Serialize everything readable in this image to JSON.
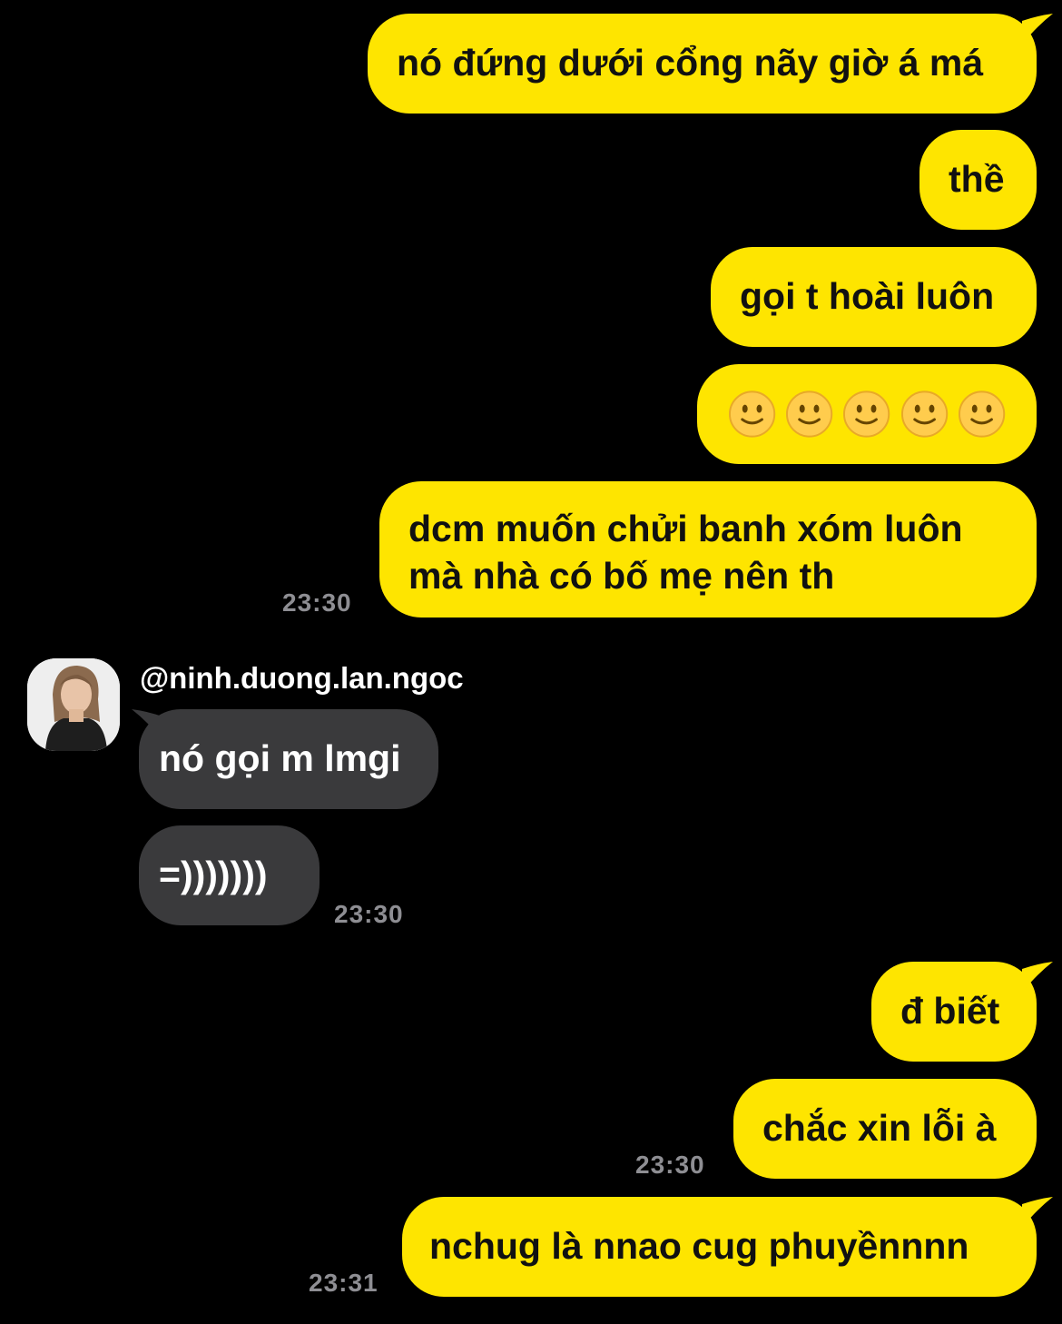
{
  "conversation": {
    "other_user": {
      "handle": "@ninh.duong.lan.ngoc",
      "avatar": "user-avatar-photo"
    },
    "colors": {
      "my_bubble": "#FEE500",
      "their_bubble": "#3A3A3C",
      "timestamp": "#8E8E93",
      "background": "#000000"
    },
    "messages": {
      "m1": "nó đứng dưới cổng nãy giờ á má",
      "m2": "thề",
      "m3": "gọi t hoài luôn",
      "m4_emoji": "slightly-smiling-face x5",
      "m5_line1": "dcm muốn chửi banh xóm luôn",
      "m5_line2": "mà nhà có bố mẹ nên th",
      "m5_time": "23:30",
      "r1": "nó gọi m lmgi",
      "r2": "=)))))))",
      "r2_time": "23:30",
      "m6": "đ biết",
      "m7": "chắc xin lỗi à",
      "m7_time": "23:30",
      "m8": "nchug là nnao cug phuyềnnnn",
      "m8_time": "23:31"
    }
  }
}
